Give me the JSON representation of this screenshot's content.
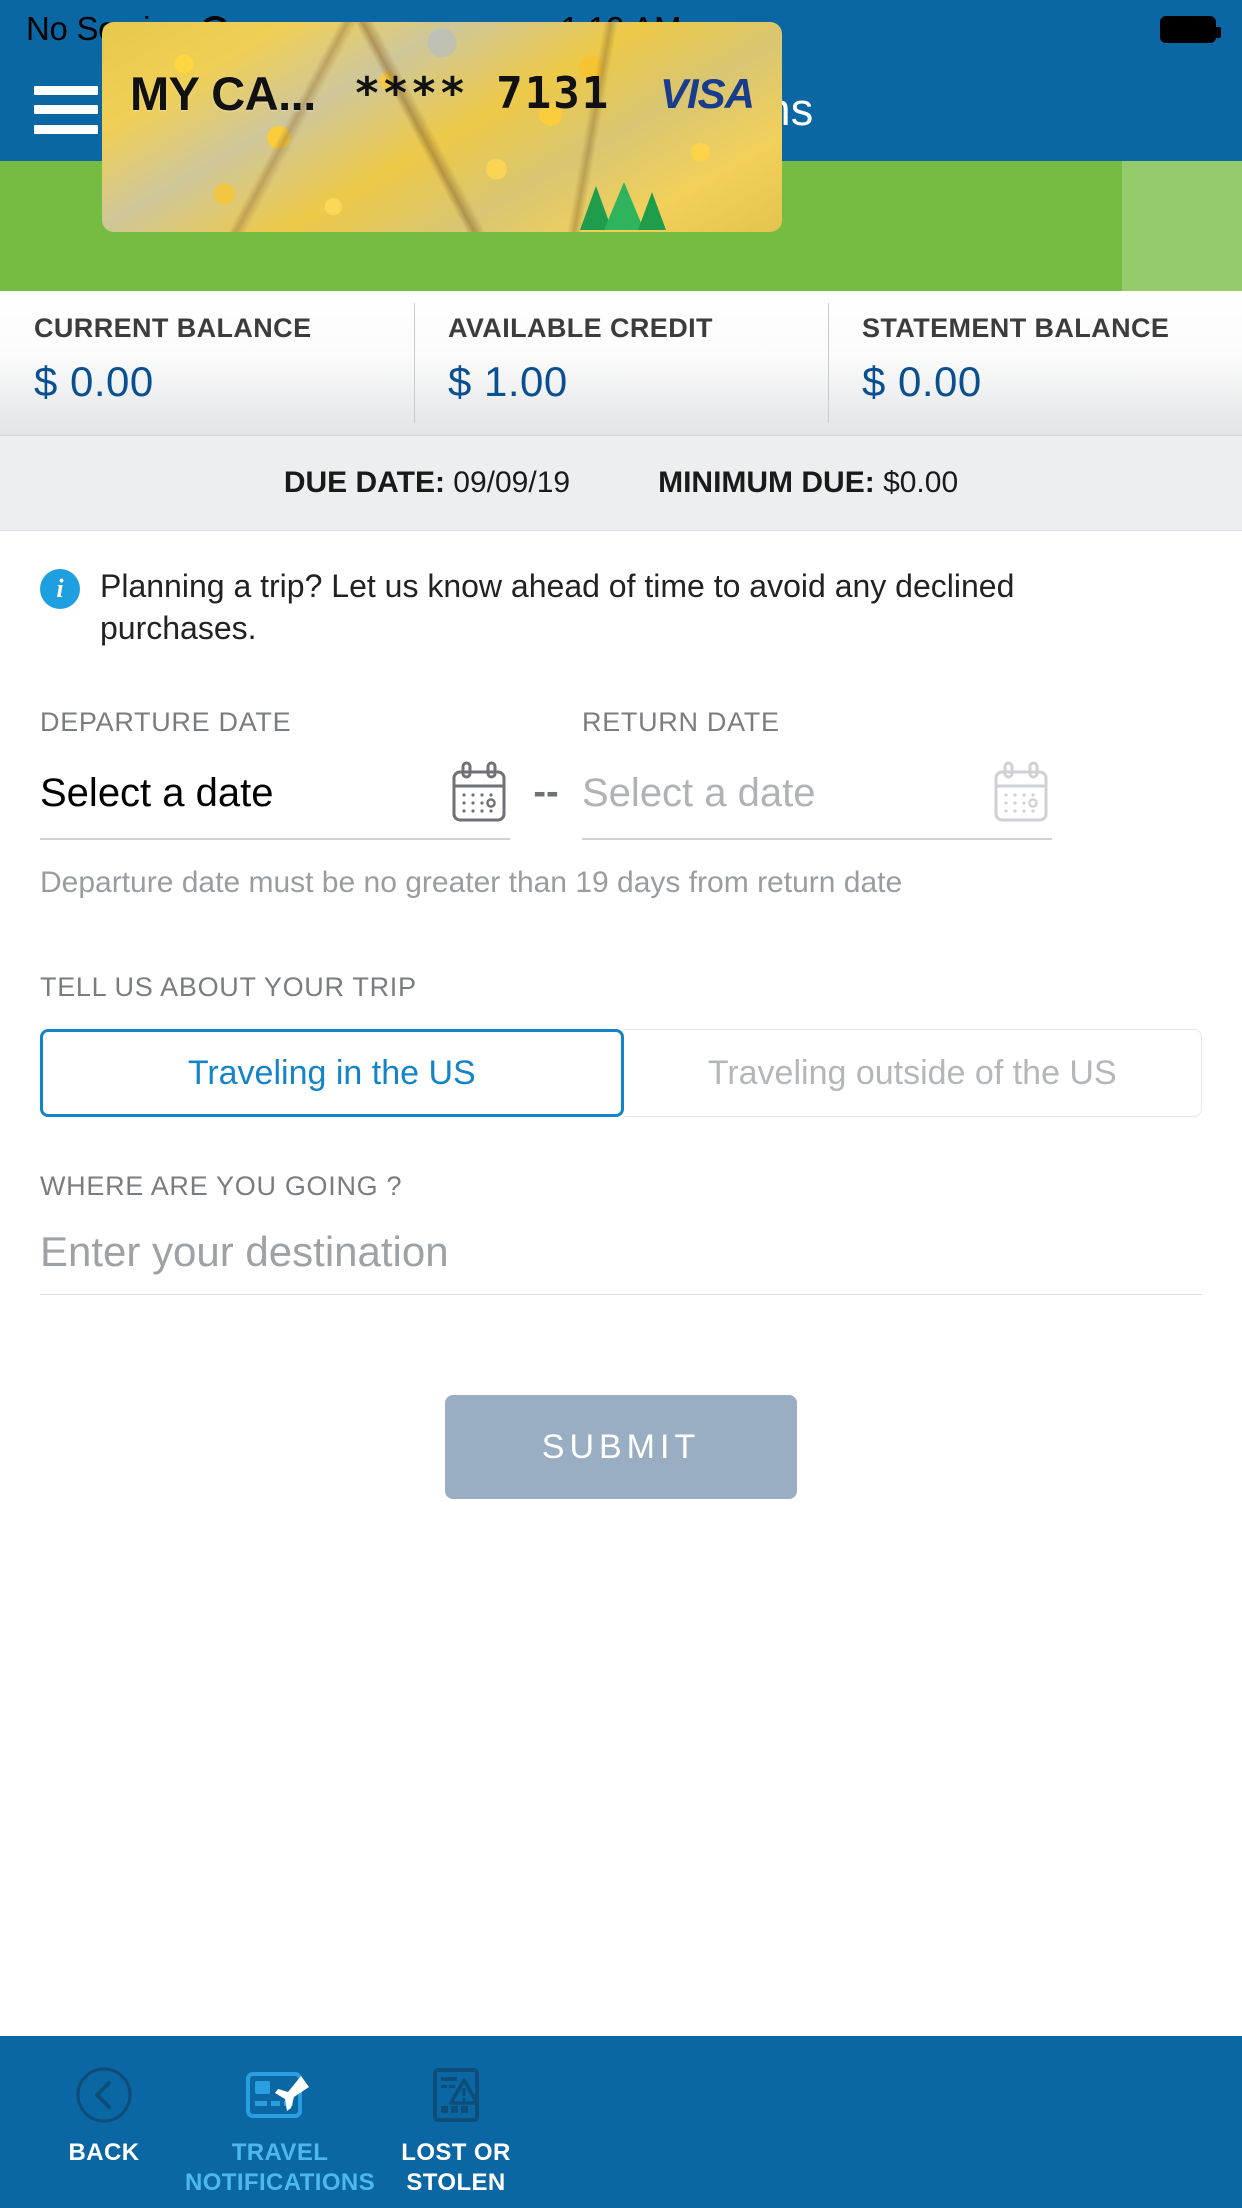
{
  "status_bar": {
    "carrier": "No Service",
    "wifi_icon": "wifi-icon",
    "time": "1:19 AM",
    "battery_icon": "battery-full-icon"
  },
  "header": {
    "menu_icon": "hamburger-menu-icon",
    "title": "Travel Notifications"
  },
  "card": {
    "nickname": "MY CA...",
    "masked_number": "**** 7131",
    "network_logo": "visa-logo",
    "art_description": "autumn-foliage-card-art"
  },
  "balances": [
    {
      "label": "CURRENT BALANCE",
      "value": "$ 0.00"
    },
    {
      "label": "AVAILABLE CREDIT",
      "value": "$ 1.00"
    },
    {
      "label": "STATEMENT BALANCE",
      "value": "$ 0.00"
    }
  ],
  "due_row": {
    "due_date_label": "DUE DATE:",
    "due_date_value": "09/09/19",
    "minimum_due_label": "MINIMUM DUE:",
    "minimum_due_value": "$0.00"
  },
  "info_banner": {
    "icon": "info-circle-icon",
    "text": "Planning a trip? Let us know ahead of time to avoid any declined purchases."
  },
  "dates": {
    "departure_label": "DEPARTURE DATE",
    "departure_value": "Select a date",
    "departure_calendar_icon": "calendar-icon",
    "separator": "--",
    "return_label": "RETURN DATE",
    "return_value": "Select a date",
    "return_calendar_icon": "calendar-icon",
    "hint": "Departure date must be no greater than 19 days from return date"
  },
  "trip": {
    "label": "TELL US ABOUT YOUR TRIP",
    "option_domestic": "Traveling in the US",
    "option_international": "Traveling outside of the US",
    "selected": "Traveling in the US"
  },
  "destination": {
    "label": "WHERE ARE YOU GOING ?",
    "placeholder": "Enter your destination",
    "value": ""
  },
  "submit": {
    "label": "SUBMIT",
    "enabled": false
  },
  "tabbar": [
    {
      "label": "BACK",
      "icon": "back-chevron-circle-icon",
      "active": false
    },
    {
      "label": "TRAVEL NOTIFICATIONS",
      "icon": "card-airplane-icon",
      "active": true
    },
    {
      "label": "LOST OR STOLEN",
      "icon": "card-warning-icon",
      "active": false
    }
  ],
  "colors": {
    "brand_blue": "#0a67a3",
    "accent_blue": "#1484c8",
    "active_tab_blue": "#4db8ef",
    "hero_green": "#76bc43",
    "value_blue": "#0a4f8f",
    "submit_disabled": "#9aaec3"
  }
}
